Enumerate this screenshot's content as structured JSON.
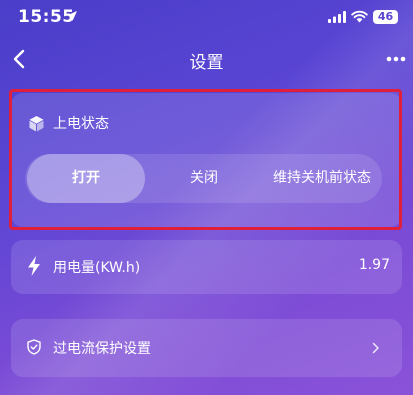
{
  "status_bar": {
    "time": "15:55",
    "battery": "46"
  },
  "nav": {
    "title": "设置"
  },
  "power_on_state": {
    "label": "上电状态",
    "options": [
      "打开",
      "关闭",
      "维持关机前状态"
    ],
    "selected": "打开"
  },
  "energy": {
    "label": "用电量(KW.h)",
    "value": "1.97"
  },
  "overcurrent": {
    "label": "过电流保护设置"
  },
  "colors": {
    "highlight": "#e0203a",
    "background": "#5a45d4"
  }
}
